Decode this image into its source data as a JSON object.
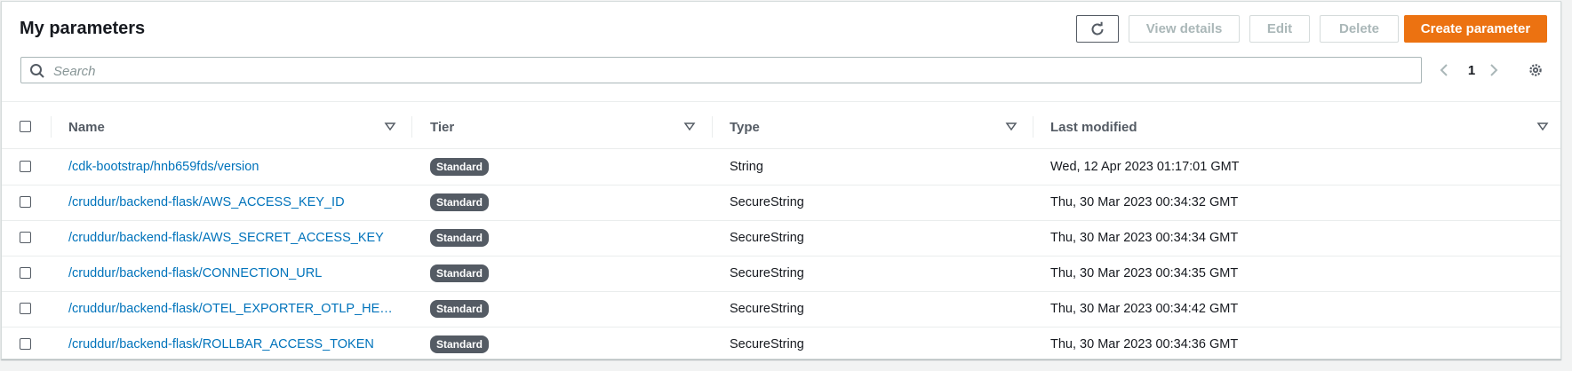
{
  "header": {
    "title": "My parameters",
    "buttons": {
      "view_details": "View details",
      "edit": "Edit",
      "delete": "Delete",
      "create": "Create parameter"
    },
    "search_placeholder": "Search",
    "page_number": "1"
  },
  "table": {
    "columns": [
      "Name",
      "Tier",
      "Type",
      "Last modified"
    ],
    "rows": [
      {
        "name": "/cdk-bootstrap/hnb659fds/version",
        "tier": "Standard",
        "type": "String",
        "modified": "Wed, 12 Apr 2023 01:17:01 GMT"
      },
      {
        "name": "/cruddur/backend-flask/AWS_ACCESS_KEY_ID",
        "tier": "Standard",
        "type": "SecureString",
        "modified": "Thu, 30 Mar 2023 00:34:32 GMT"
      },
      {
        "name": "/cruddur/backend-flask/AWS_SECRET_ACCESS_KEY",
        "tier": "Standard",
        "type": "SecureString",
        "modified": "Thu, 30 Mar 2023 00:34:34 GMT"
      },
      {
        "name": "/cruddur/backend-flask/CONNECTION_URL",
        "tier": "Standard",
        "type": "SecureString",
        "modified": "Thu, 30 Mar 2023 00:34:35 GMT"
      },
      {
        "name": "/cruddur/backend-flask/OTEL_EXPORTER_OTLP_HEAD…",
        "tier": "Standard",
        "type": "SecureString",
        "modified": "Thu, 30 Mar 2023 00:34:42 GMT"
      },
      {
        "name": "/cruddur/backend-flask/ROLLBAR_ACCESS_TOKEN",
        "tier": "Standard",
        "type": "SecureString",
        "modified": "Thu, 30 Mar 2023 00:34:36 GMT"
      }
    ]
  },
  "colors": {
    "primary": "#ec7211",
    "link": "#0073bb",
    "badge": "#545b64"
  }
}
